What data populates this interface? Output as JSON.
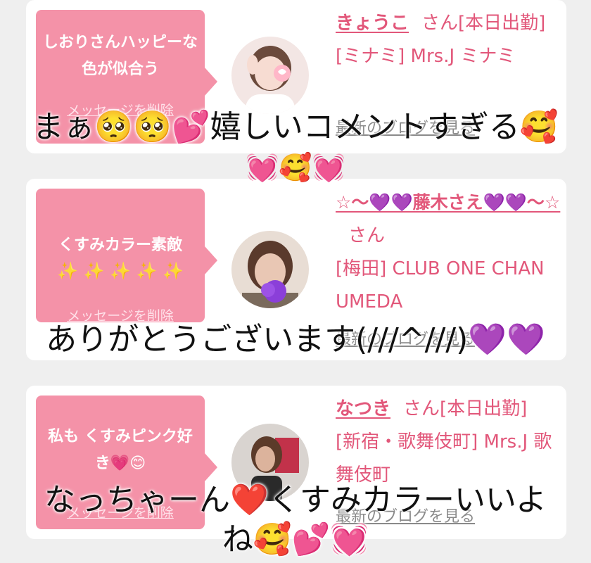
{
  "cards": [
    {
      "bubble_text": "しおりさんハッピーな色が似合う",
      "delete_label": "メッセージを削除",
      "name": "きょうこ",
      "san": "さん",
      "status": "[本日出勤]",
      "shop": "[ミナミ] Mrs.J ミナミ",
      "blog": "最新のブログを見る"
    },
    {
      "bubble_text": "くすみカラー素敵",
      "bubble_emoji": "✨ ✨ ✨ ✨ ✨",
      "delete_label": "メッセージを削除",
      "name": "☆〜💜💜藤木さえ💜💜〜☆",
      "san": "さん",
      "shop": "[梅田] CLUB ONE CHAN UMEDA",
      "blog": "最新のブログを見る"
    },
    {
      "bubble_text": "私も くすみピンク好き💗😊",
      "delete_label": "メッセージを削除",
      "name": "なつき",
      "san": "さん",
      "status": "[本日出勤]",
      "shop": "[新宿・歌舞伎町] Mrs.J 歌舞伎町",
      "blog": "最新のブログを見る"
    }
  ],
  "overlays": {
    "first_line": "まぁ🥺🥺💕嬉しいコメントすぎる🥰",
    "first_emoji": "💓🥰💓",
    "second_line": "ありがとうございます(///^///)💜💜",
    "third_line": "なっちゃーん❤️くすみカラーいいよ",
    "third_line2": "ね🥰💕💓"
  },
  "colors": {
    "accent_pink": "#f492a8",
    "name_pink": "#e2577a",
    "background": "#efefef"
  }
}
